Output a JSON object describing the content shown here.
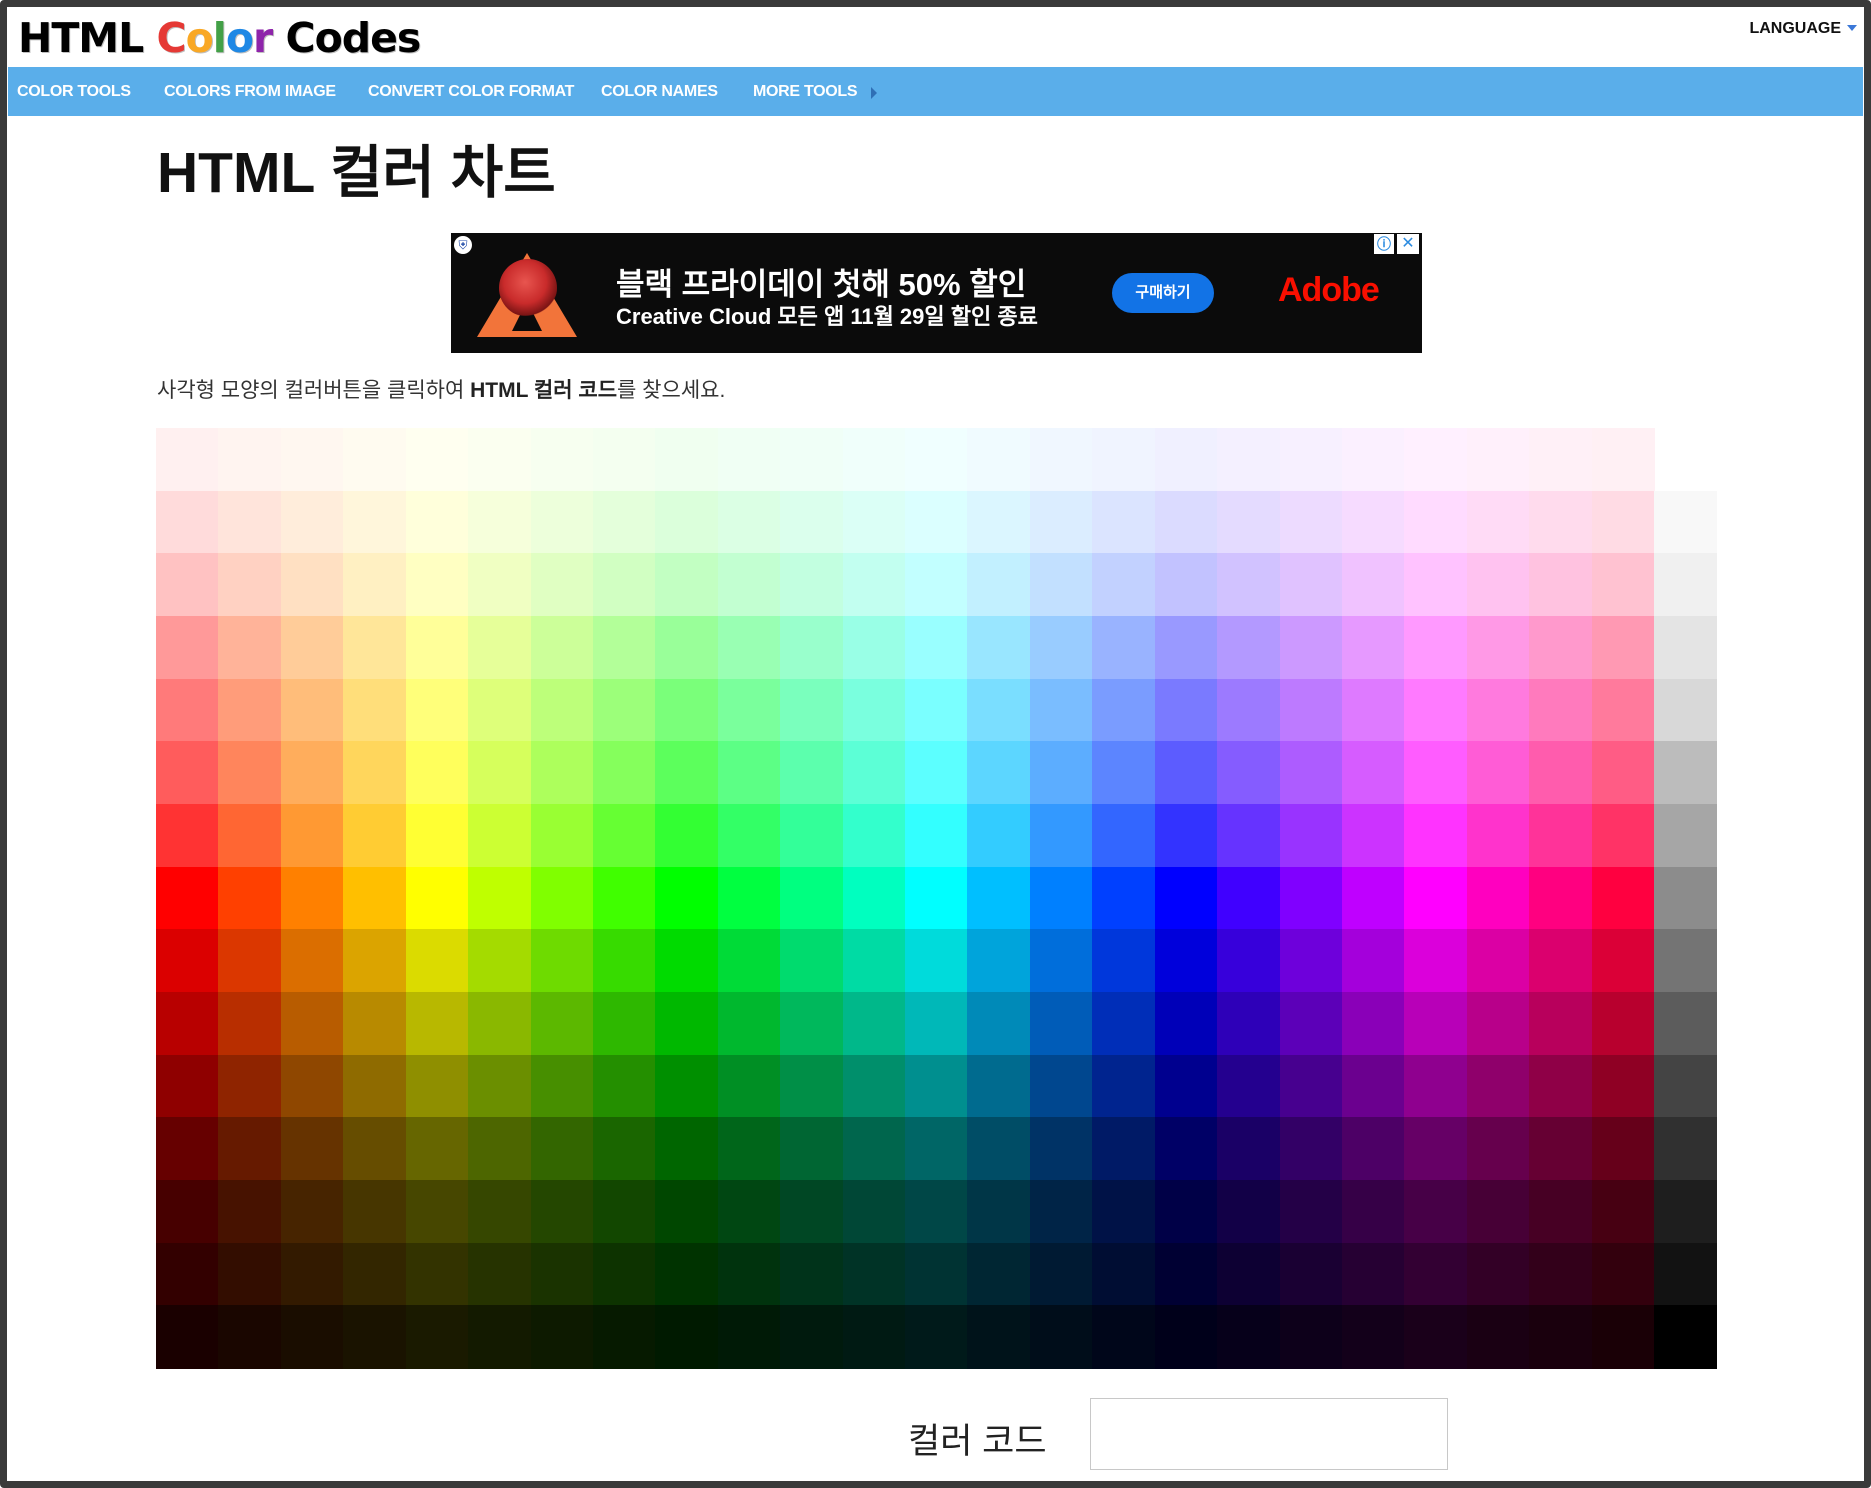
{
  "header": {
    "logo": {
      "html": "HTML ",
      "color_letters": [
        "C",
        "o",
        "l",
        "o",
        "r"
      ],
      "color_letter_colors": [
        "#e53935",
        "#f9a825",
        "#43a047",
        "#1e88e5",
        "#8e24aa"
      ],
      "codes": " Codes"
    },
    "language_label": "LANGUAGE"
  },
  "nav": {
    "items": [
      {
        "label": "COLOR TOOLS"
      },
      {
        "label": "COLORS FROM IMAGE"
      },
      {
        "label": "CONVERT COLOR FORMAT"
      },
      {
        "label": "COLOR NAMES"
      },
      {
        "label": "MORE TOOLS"
      }
    ],
    "background": "#5aaeea"
  },
  "page": {
    "title": "HTML 컬러 차트",
    "desc_prefix": "사각형 모양의 컬러버튼을 클릭하여 ",
    "desc_bold": "HTML 컬러 코드",
    "desc_suffix": "를 찾으세요."
  },
  "ad": {
    "headline": "블랙 프라이데이 첫해 50% 할인",
    "subline": "Creative Cloud 모든 앱 11월 29일 할인 종료",
    "button": "구매하기",
    "brand": "Adobe",
    "info_icon": "ⓘ",
    "close_icon": "✕"
  },
  "color_chart": {
    "hue_columns": 24,
    "rows": 15,
    "hue_step_deg": 15,
    "row_lightness": [
      97,
      93,
      88,
      80,
      74,
      68,
      60,
      50,
      43,
      36,
      28,
      20,
      14,
      10,
      5
    ],
    "grayscale_values": [
      "#ffffff",
      "#f8f8f8",
      "#f0f0f0",
      "#e4e4e4",
      "#d8d8d8",
      "#bcbcbc",
      "#a6a6a6",
      "#8c8c8c",
      "#747474",
      "#5c5c5c",
      "#444444",
      "#303030",
      "#1e1e1e",
      "#121212",
      "#000000"
    ]
  },
  "code": {
    "label": "컬러 코드",
    "value": "",
    "placeholder": ""
  }
}
